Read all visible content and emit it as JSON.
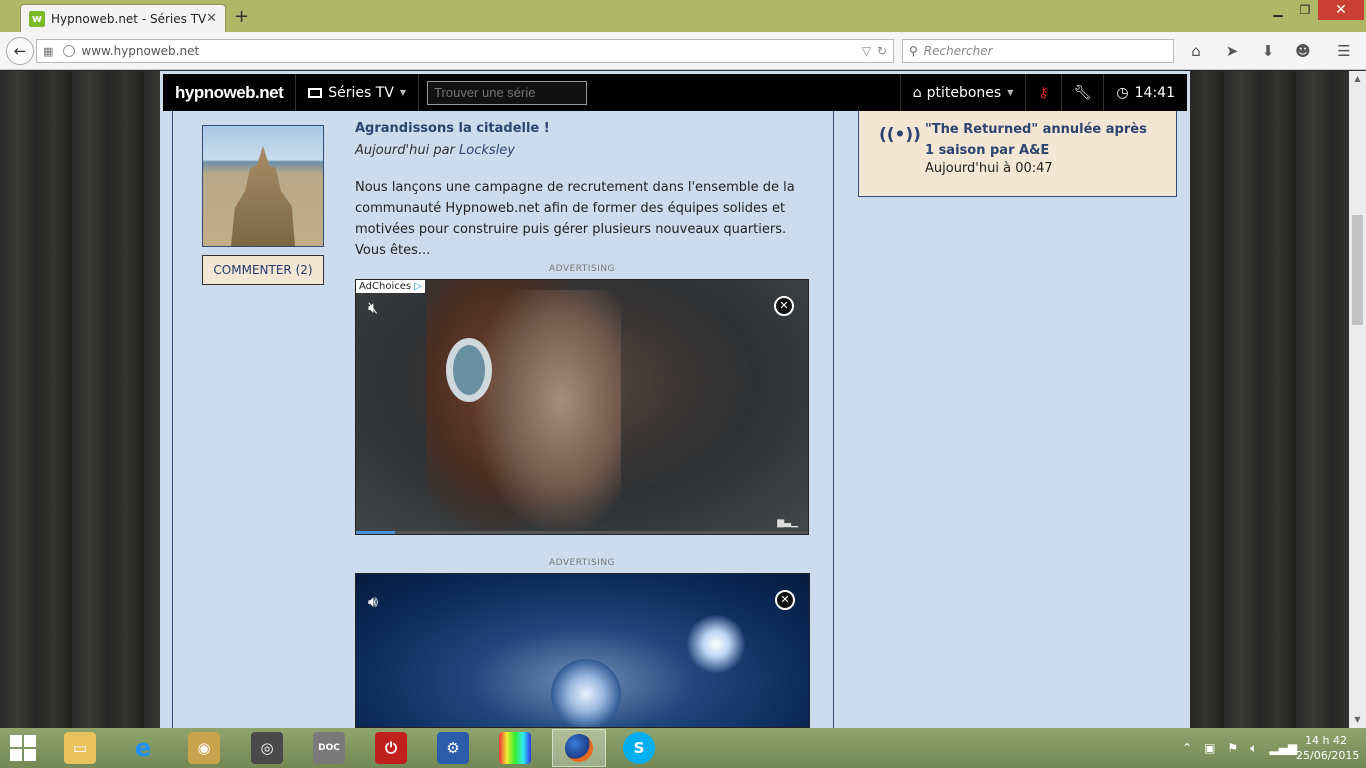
{
  "browser": {
    "tab_title": "Hypnoweb.net - Séries TV",
    "tab_favicon": "w",
    "url": "www.hypnoweb.net",
    "search_placeholder": "Rechercher"
  },
  "site": {
    "logo": "hypnoweb.net",
    "menu_series": "Séries TV",
    "find_placeholder": "Trouver une série",
    "user": "ptitebones",
    "time": "14:41"
  },
  "article": {
    "title": "Agrandissons la citadelle !",
    "meta_prefix": "Aujourd'hui par",
    "author": "Locksley",
    "body": "Nous lançons une campagne de recrutement dans l'ensemble de la communauté Hypnoweb.net afin de former des équipes solides et motivées pour construire puis gérer plusieurs nouveaux quartiers. Vous êtes...",
    "comment_button": "COMMENTER (2)"
  },
  "ads": {
    "label_1": "ADVERTISING",
    "label_2": "ADVERTISING",
    "adchoices": "AdChoices",
    "progress_fraction": 0.085
  },
  "news": {
    "title": "\"The Returned\" annulée après 1 saison par A&E",
    "time": "Aujourd'hui à 00:47"
  },
  "taskbar": {
    "clock_time": "14 h 42",
    "clock_date": "25/06/2015"
  },
  "colors": {
    "titlebar": "#aeb867",
    "site_bg": "#ccdcec",
    "card_bg": "#f3e6d4",
    "link": "#2c4470",
    "close_red": "#c84031"
  }
}
